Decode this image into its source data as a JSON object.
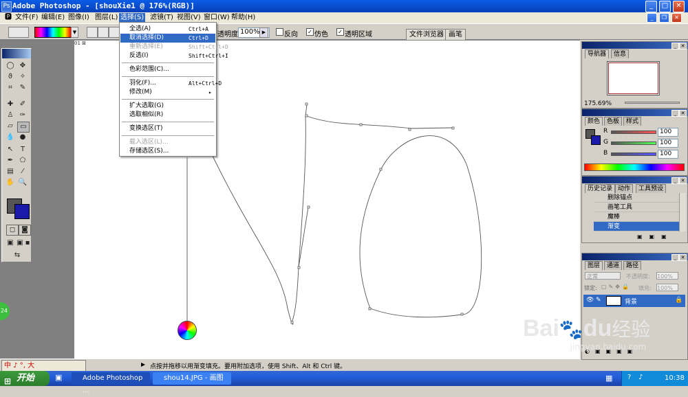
{
  "app": {
    "title": "Adobe Photoshop - [shouXie1 @ 176%(RGB)]"
  },
  "menubar": {
    "items": [
      "文件(F)",
      "编辑(E)",
      "图像(I)",
      "图层(L)",
      "选择(S)",
      "滤镜(T)",
      "视图(V)",
      "窗口(W)",
      "帮助(H)"
    ],
    "active": "选择(S)"
  },
  "options": {
    "opacity_label": "透明度:",
    "opacity_value": "100%",
    "reverse_label": "反向",
    "dither_label": "仿色",
    "transparency_label": "透明区域",
    "tab_file_browser": "文件浏览器",
    "tab_brushes": "画笔"
  },
  "select_menu": {
    "items": [
      {
        "label": "全选(A)",
        "shortcut": "Ctrl+A",
        "state": "normal"
      },
      {
        "label": "取消选择(D)",
        "shortcut": "Ctrl+D",
        "state": "highlighted"
      },
      {
        "label": "重新选择(E)",
        "shortcut": "Shift+Ctrl+D",
        "state": "disabled"
      },
      {
        "label": "反选(I)",
        "shortcut": "Shift+Ctrl+I",
        "state": "normal"
      },
      {
        "label": "色彩范围(C)...",
        "shortcut": "",
        "state": "normal"
      },
      {
        "label": "羽化(F)...",
        "shortcut": "Alt+Ctrl+D",
        "state": "normal"
      },
      {
        "label": "修改(M)",
        "shortcut": "▸",
        "state": "normal"
      },
      {
        "label": "扩大选取(G)",
        "shortcut": "",
        "state": "normal"
      },
      {
        "label": "选取相似(R)",
        "shortcut": "",
        "state": "normal"
      },
      {
        "label": "变换选区(T)",
        "shortcut": "",
        "state": "normal"
      },
      {
        "label": "载入选区(L)...",
        "shortcut": "",
        "state": "disabled"
      },
      {
        "label": "存储选区(S)...",
        "shortcut": "",
        "state": "normal"
      }
    ]
  },
  "navigator": {
    "tab1": "导航器",
    "tab2": "信息",
    "zoom": "175.69%"
  },
  "color_panel": {
    "tab1": "颜色",
    "tab2": "色板",
    "tab3": "样式",
    "r_label": "R",
    "g_label": "G",
    "b_label": "B",
    "r": "100",
    "g": "100",
    "b": "100",
    "colors": {
      "foreground": "#555555",
      "background": "#1a1aa8"
    }
  },
  "history_panel": {
    "tab1": "历史记录",
    "tab2": "动作",
    "tab3": "工具预设",
    "items": [
      "删除锚点",
      "画笔工具",
      "魔棒",
      "渐变"
    ],
    "selected": "渐变"
  },
  "layers_panel": {
    "tab1": "图层",
    "tab2": "通道",
    "tab3": "路径",
    "blend_mode": "正常",
    "opacity_label": "不透明度:",
    "opacity": "100%",
    "lock_label": "锁定:",
    "fill_label": "填充:",
    "fill": "100%",
    "layer_name": "背景"
  },
  "status": {
    "ime": "中 ♪ °, 大",
    "message": "点按并拖移以用渐变填充。要用附加选项，使用 Shift、Alt 和 Ctrl 键。",
    "badge": "24"
  },
  "taskbar": {
    "start": "开始",
    "item1": "Adobe Photoshop ...",
    "item2": "shou14.JPG - 画图",
    "clock": "10:38"
  },
  "watermark": {
    "brand": "Bai",
    "brand2": "du",
    "cn": "经验",
    "url": "jingyan.baidu.com"
  },
  "colors": {
    "titlebar": "#0a5ce6",
    "highlight": "#316ac5",
    "taskbar": "#245edb"
  }
}
